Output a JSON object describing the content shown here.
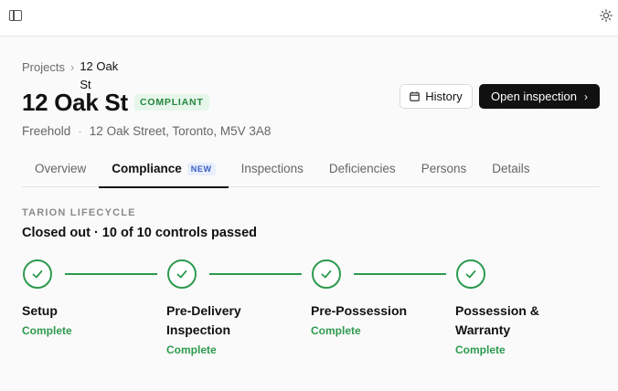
{
  "breadcrumb": {
    "parent": "Projects",
    "separator": "›",
    "current": "12 Oak St"
  },
  "page": {
    "title": "12 Oak St",
    "status_badge": "COMPLIANT"
  },
  "actions": {
    "history_label": "History",
    "open_inspection_label": "Open inspection"
  },
  "subtitle": {
    "tenure": "Freehold",
    "separator": "·",
    "address": "12 Oak Street, Toronto, M5V 3A8"
  },
  "tabs": [
    {
      "label": "Overview"
    },
    {
      "label": "Compliance",
      "badge": "NEW",
      "active": true
    },
    {
      "label": "Inspections"
    },
    {
      "label": "Deficiencies"
    },
    {
      "label": "Persons"
    },
    {
      "label": "Details"
    }
  ],
  "lifecycle": {
    "section_label": "TARION LIFECYCLE",
    "summary": "Closed out · 10 of 10 controls passed",
    "steps": [
      {
        "name": "Setup",
        "status": "Complete"
      },
      {
        "name": "Pre-Delivery Inspection",
        "status": "Complete"
      },
      {
        "name": "Pre-Possession",
        "status": "Complete"
      },
      {
        "name": "Possession & Warranty",
        "status": "Complete"
      }
    ]
  },
  "colors": {
    "success": "#2d9a4e",
    "badge_bg": "#e7f6ea",
    "primary_button": "#111111"
  },
  "icons": {
    "sidebar_toggle": "sidebar-icon",
    "theme": "sun-icon",
    "history": "calendar-icon",
    "open": "chevron-right-icon",
    "step": "check-icon"
  }
}
